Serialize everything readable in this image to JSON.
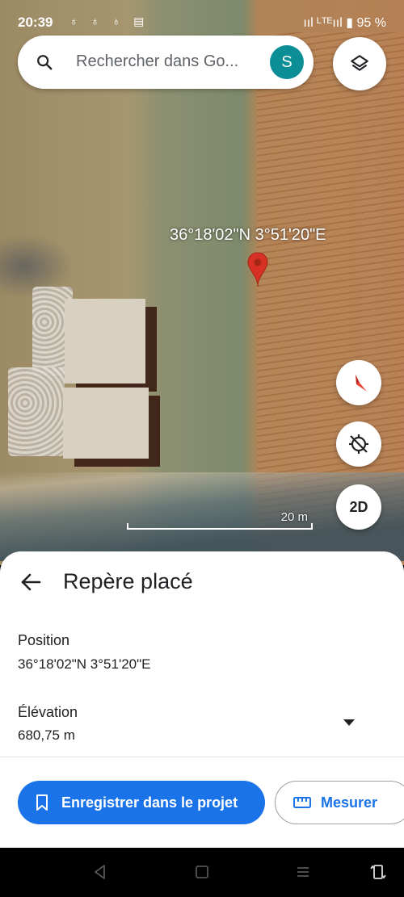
{
  "status": {
    "time": "20:39",
    "notification_icons": "♁ ♁ ♁ ▤",
    "network": "ııl ᴸᵀᴱııl",
    "battery": "95 %"
  },
  "search": {
    "placeholder": "Rechercher dans Go...",
    "avatar_letter": "S"
  },
  "map": {
    "marker_coords": "36°18'02\"N 3°51'20\"E",
    "scale_label": "20 m",
    "mode_button": "2D"
  },
  "sheet": {
    "title": "Repère placé",
    "position_label": "Position",
    "position_value": "36°18'02\"N 3°51'20\"E",
    "elevation_label": "Élévation",
    "elevation_value": "680,75 m"
  },
  "actions": {
    "save_label": "Enregistrer dans le projet",
    "measure_label": "Mesurer"
  },
  "colors": {
    "accent": "#1a73e8",
    "avatar": "#0b8e95",
    "pin": "#d93025"
  },
  "icons": [
    "search-icon",
    "layers-icon",
    "compass-icon",
    "location-off-icon",
    "back-arrow-icon",
    "dropdown-icon",
    "bookmark-icon",
    "ruler-icon",
    "nav-back-icon",
    "nav-home-icon",
    "nav-menu-icon",
    "nav-rotate-icon"
  ]
}
